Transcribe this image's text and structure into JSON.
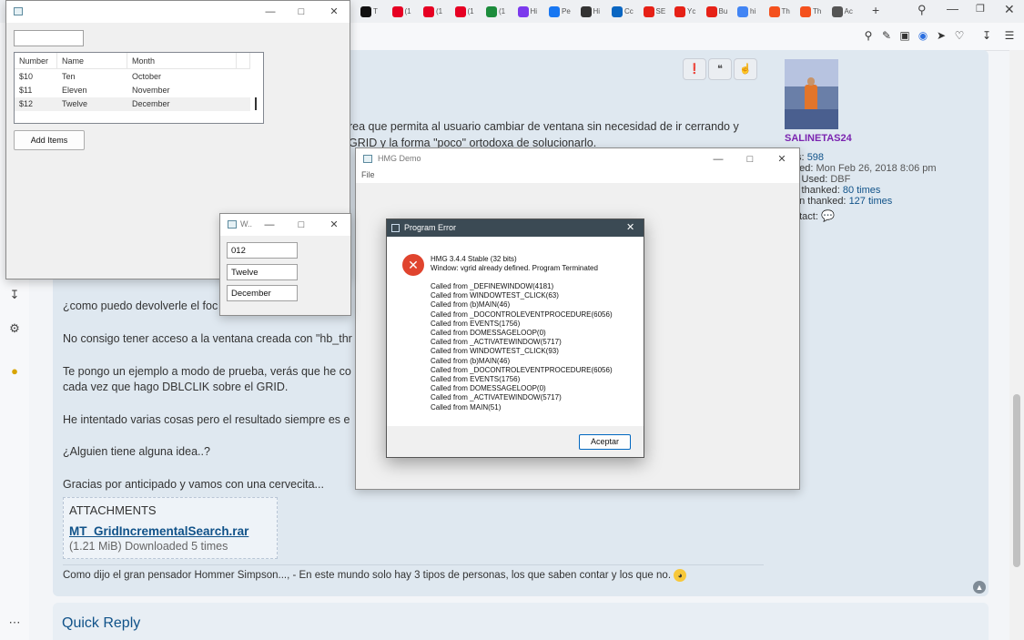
{
  "browser": {
    "tabs": [
      {
        "label": "T",
        "color": "#111111"
      },
      {
        "label": "(1",
        "color": "#e60023"
      },
      {
        "label": "(1",
        "color": "#e60023"
      },
      {
        "label": "(1",
        "color": "#e60023"
      },
      {
        "label": "(1",
        "color": "#1c8c3c"
      },
      {
        "label": "Hi",
        "color": "#7c3aed"
      },
      {
        "label": "Pe",
        "color": "#1877f2"
      },
      {
        "label": "Hi",
        "color": "#333333"
      },
      {
        "label": "Cc",
        "color": "#0a66c2"
      },
      {
        "label": "SE",
        "color": "#e62117"
      },
      {
        "label": "Yc",
        "color": "#e62117"
      },
      {
        "label": "Bu",
        "color": "#e62117"
      },
      {
        "label": "hi",
        "color": "#4285f4"
      },
      {
        "label": "Th",
        "color": "#f4511e"
      },
      {
        "label": "Th",
        "color": "#f4511e"
      },
      {
        "label": "Ac",
        "color": "#555555"
      }
    ],
    "new_tab": "+"
  },
  "forum": {
    "text_lines": [
      "rea que permita al usuario cambiar de ventana sin necesidad de ir cerrando y",
      "GRID y la forma \"poco\" ortodoxa de solucionarlo.",
      "¿como puedo devolverle el foc",
      "No consigo tener acceso a la ventana creada con \"hb_thr",
      "Te pongo un ejemplo a modo de prueba, verás que he co",
      "cada vez que hago DBLCLIK sobre el GRID.",
      "He intentado varias cosas pero el resultado siempre es e",
      "¿Alguien tiene alguna idea..?",
      "Gracias por anticipado y vamos con una cervecita..."
    ],
    "attachments_heading": "ATTACHMENTS",
    "attachment_name": "MT_GridIncrementalSearch.rar",
    "attachment_info": "(1.21 MiB) Downloaded 5 times",
    "signature": "Como dijo el gran pensador Hommer Simpson..., - En este mundo solo hay 3 tipos de personas, los que saben contar y los que no.",
    "quick_reply": "Quick Reply",
    "profile": {
      "username": "SALINETAS24",
      "posts_label": "ts:",
      "posts_value": "598",
      "joined_label": "ned:",
      "joined_value": "Mon Feb 26, 2018 8:06 pm",
      "used_label": "s Used:",
      "used_value": "DBF",
      "thanked_label": "s thanked:",
      "thanked_value": "80 times",
      "been_label": "en thanked:",
      "been_value": "127 times",
      "contact_label": "ntact:"
    }
  },
  "grid_window": {
    "search_value": "",
    "columns": [
      "Number",
      "Name",
      "Month"
    ],
    "rows": [
      [
        "$10",
        "Ten",
        "October"
      ],
      [
        "$11",
        "Eleven",
        "November"
      ],
      [
        "$12",
        "Twelve",
        "December"
      ]
    ],
    "add_button": "Add Items"
  },
  "small_window": {
    "title": "W..",
    "field1": "012",
    "field2": "Twelve",
    "field3": "December"
  },
  "hmg_window": {
    "title": "HMG Demo",
    "menu_file": "File"
  },
  "error_dialog": {
    "title": "Program Error",
    "header1": "HMG 3.4.4 Stable (32 bits)",
    "header2": "Window: vgrid already defined. Program Terminated",
    "calls": [
      "Called from _DEFINEWINDOW(4181)",
      "Called from WINDOWTEST_CLICK(63)",
      "Called from (b)MAIN(46)",
      "Called from _DOCONTROLEVENTPROCEDURE(6056)",
      "Called from EVENTS(1756)",
      "Called from DOMESSAGELOOP(0)",
      "Called from _ACTIVATEWINDOW(5717)",
      "Called from WINDOWTEST_CLICK(93)",
      "Called from (b)MAIN(46)",
      "Called from _DOCONTROLEVENTPROCEDURE(6056)",
      "Called from EVENTS(1756)",
      "Called from DOMESSAGELOOP(0)",
      "Called from _ACTIVATEWINDOW(5717)",
      "Called from MAIN(51)"
    ],
    "ok_button": "Aceptar"
  }
}
